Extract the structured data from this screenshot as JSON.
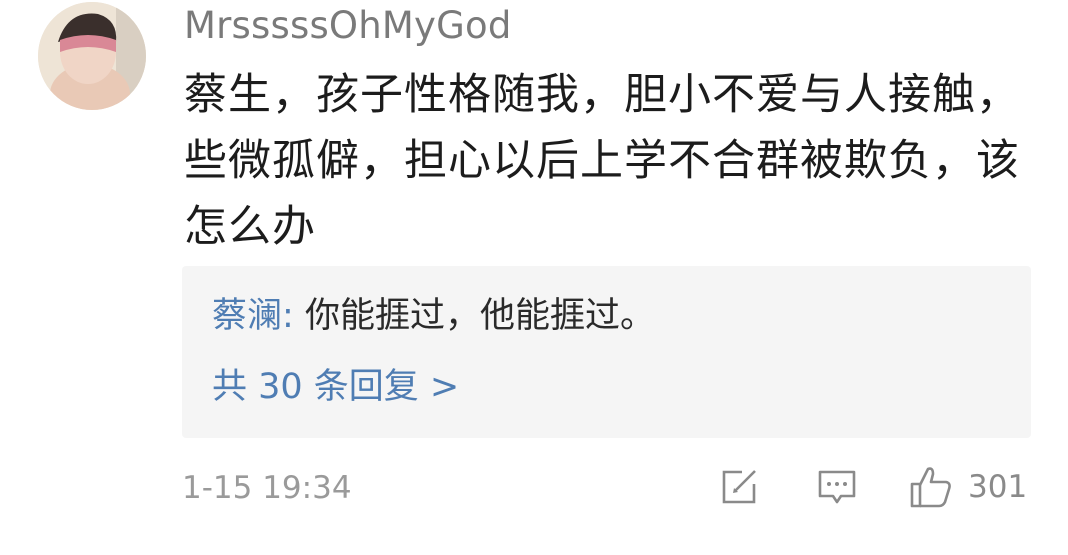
{
  "comment": {
    "username": "MrsssssOhMyGod",
    "text": "蔡生，孩子性格随我，胆小不爱与人接触，些微孤僻，担心以后上学不合群被欺负，该怎么办",
    "timestamp": "1-15 19:34"
  },
  "reply": {
    "author": "蔡澜",
    "separator": ": ",
    "content": "你能捱过，他能捱过。",
    "count_label": "共 30 条回复 >"
  },
  "actions": {
    "share_icon": "share-icon",
    "comment_icon": "comment-icon",
    "like_icon": "thumbs-up-icon",
    "like_count": "301"
  },
  "colors": {
    "link": "#4f7db3",
    "username": "#7a7a7a",
    "meta": "#9a9a9a",
    "reply_bg": "#f5f5f5"
  }
}
